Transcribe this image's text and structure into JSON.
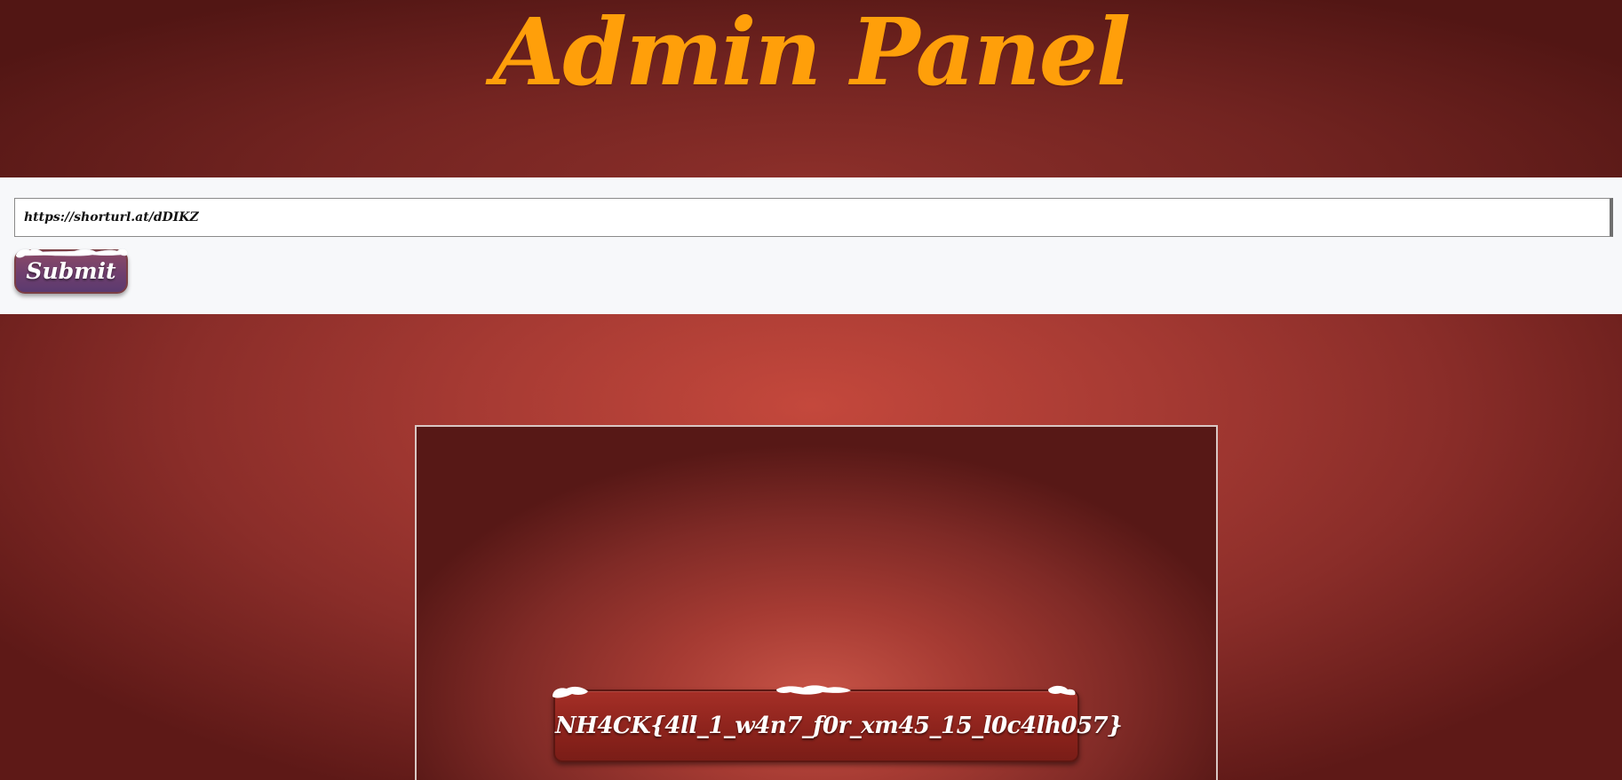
{
  "header": {
    "title": "Admin Panel"
  },
  "form": {
    "url_value": "https://shorturl.at/dDIKZ",
    "submit_label": "Submit"
  },
  "result": {
    "flag_text": "NH4CK{4ll_1_w4n7_f0r_xm45_15_l0c4lh057}"
  },
  "colors": {
    "title": "#ff9f0a",
    "background": "#a63a33",
    "form_band": "#f7f8fa",
    "submit_button": "#6f3f6e",
    "banner": "#8d231c"
  },
  "icons": {
    "snow_caps": "snow-cap-icon"
  }
}
